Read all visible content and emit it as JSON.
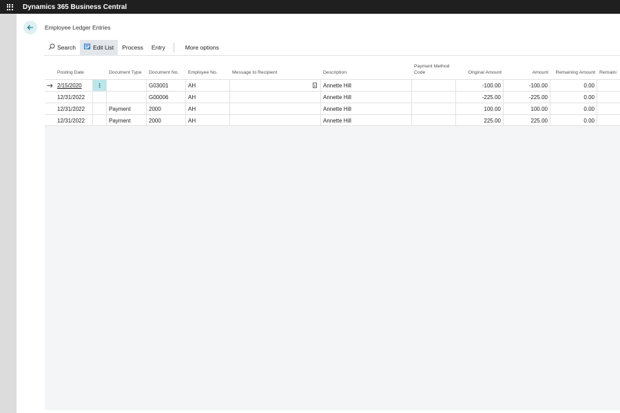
{
  "app": {
    "title": "Dynamics 365 Business Central"
  },
  "page": {
    "title": "Employee Ledger Entries"
  },
  "toolbar": {
    "search_label": "Search",
    "edit_list_label": "Edit List",
    "process_label": "Process",
    "entry_label": "Entry",
    "more_options_label": "More options"
  },
  "columns": {
    "posting_date": "Posting Date",
    "document_type": "Document Type",
    "document_no": "Document No.",
    "employee_no": "Employee No.",
    "message_to_recipient": "Message to Recipient",
    "description": "Description",
    "payment_method_code": "Payment Method Code",
    "original_amount": "Original Amount",
    "amount": "Amount",
    "remaining_amount": "Remaining Amount",
    "remaining_truncated": "Remaini"
  },
  "rows": [
    {
      "posting_date": "2/15/2020",
      "document_type": "",
      "document_no": "G03001",
      "employee_no": "AH",
      "message_to_recipient": "",
      "description": "Annette Hill",
      "payment_method_code": "",
      "original_amount": "-100.00",
      "amount": "-100.00",
      "remaining_amount": "0.00"
    },
    {
      "posting_date": "12/31/2022",
      "document_type": "",
      "document_no": "G00006",
      "employee_no": "AH",
      "message_to_recipient": "",
      "description": "Annette Hill",
      "payment_method_code": "",
      "original_amount": "-225.00",
      "amount": "-225.00",
      "remaining_amount": "0.00"
    },
    {
      "posting_date": "12/31/2022",
      "document_type": "Payment",
      "document_no": "2000",
      "employee_no": "AH",
      "message_to_recipient": "",
      "description": "Annette Hill",
      "payment_method_code": "",
      "original_amount": "100.00",
      "amount": "100.00",
      "remaining_amount": "0.00"
    },
    {
      "posting_date": "12/31/2022",
      "document_type": "Payment",
      "document_no": "2000",
      "employee_no": "AH",
      "message_to_recipient": "",
      "description": "Annette Hill",
      "payment_method_code": "",
      "original_amount": "225.00",
      "amount": "225.00",
      "remaining_amount": "0.00"
    }
  ],
  "icons": {
    "waffle": "app-launcher-icon",
    "back": "back-arrow-icon",
    "search": "search-icon",
    "edit_list": "edit-list-icon",
    "row_marker": "current-row-arrow-icon",
    "row_menu": "row-actions-icon",
    "note": "note-icon"
  },
  "colors": {
    "topbar": "#1f1f1f",
    "accent": "#006c75",
    "selected_cell": "#bde6ea"
  }
}
